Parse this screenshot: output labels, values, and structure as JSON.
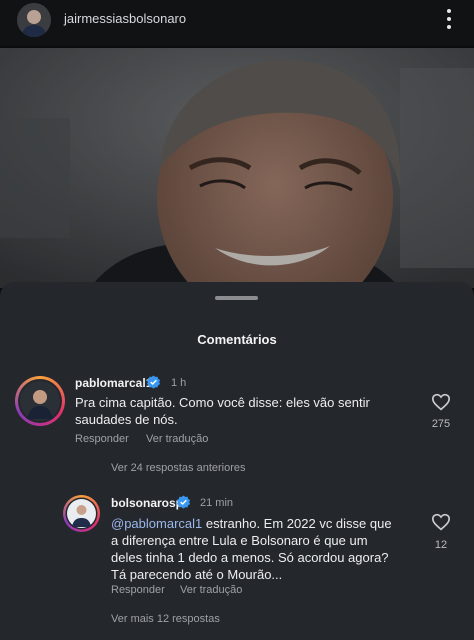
{
  "post": {
    "username": "jairmessiasbolsonaro"
  },
  "sheet": {
    "title": "Comentários"
  },
  "comments": [
    {
      "username": "pablomarcal1",
      "time": "1 h",
      "text": "Pra cima capitão. Como você disse: eles vão sentir saudades de nós.",
      "reply_label": "Responder",
      "translate_label": "Ver tradução",
      "likes": "275",
      "view_replies": "Ver 24 respostas anteriores"
    },
    {
      "username": "bolsonarosp",
      "time": "21 min",
      "mention": "@pablomarcal1",
      "text": " estranho. Em 2022 vc disse que a diferença entre Lula e Bolsonaro é que um deles tinha 1 dedo a menos. Só acordou agora? Tá parecendo até o Mourão...",
      "reply_label": "Responder",
      "translate_label": "Ver tradução",
      "likes": "12",
      "view_more": "Ver mais 12 respostas"
    }
  ],
  "colors": {
    "sheet_bg": "#24272b",
    "verified_blue": "#3897f0",
    "mention": "#9bb8ec",
    "muted_text": "#9ea1a6"
  },
  "icons": [
    "more-options-icon",
    "verified-badge-icon",
    "heart-outline-icon"
  ]
}
